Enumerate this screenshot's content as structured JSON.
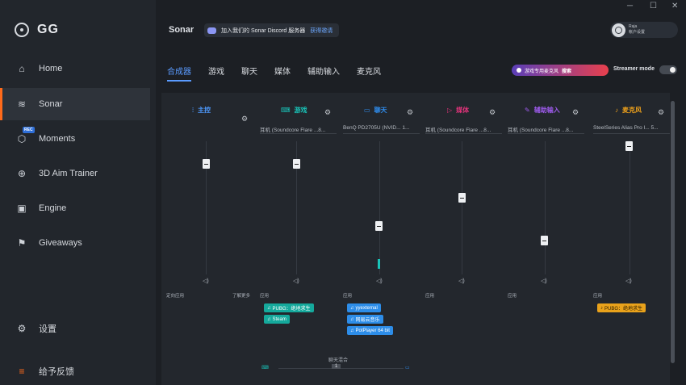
{
  "brand": {
    "name": "GG"
  },
  "window": {
    "minimize": "─",
    "maximize": "☐",
    "close": "✕"
  },
  "nav": [
    {
      "label": "Home",
      "icon": "home-icon"
    },
    {
      "label": "Sonar",
      "icon": "sonar-icon",
      "active": true
    },
    {
      "label": "Moments",
      "icon": "moments-icon",
      "badge": "REC"
    },
    {
      "label": "3D Aim Trainer",
      "icon": "crosshair-icon"
    },
    {
      "label": "Engine",
      "icon": "chip-icon"
    },
    {
      "label": "Giveaways",
      "icon": "gift-icon"
    }
  ],
  "sidebar_bottom": {
    "settings": "设置",
    "feedback": "给予反馈"
  },
  "header": {
    "title": "Sonar",
    "discord_text": "加入我们的 Sonar Discord 服务器",
    "discord_link": "获得邀请",
    "account_name": "Raja",
    "account_sub": "帐户设置"
  },
  "tabs": [
    "合成器",
    "游戏",
    "聊天",
    "媒体",
    "辅助输入",
    "麦克风"
  ],
  "mic_pill": {
    "text": "游戏专用麦克风",
    "action": "搜索"
  },
  "streamer_mode": {
    "label": "Streamer mode",
    "on": false
  },
  "channels": [
    {
      "name": "主控",
      "color": "#4e9bff",
      "device": "",
      "level": 0.86
    },
    {
      "name": "游戏",
      "color": "#19c3b8",
      "device": "耳机 (Soundcore Flare ...8...",
      "level": 0.86
    },
    {
      "name": "聊天",
      "color": "#2f8ef0",
      "device": "BenQ PD2705U (NVID... 1...",
      "level": 0.37
    },
    {
      "name": "媒体",
      "color": "#e0337a",
      "device": "耳机 (Soundcore Flare ...8...",
      "level": 0.56
    },
    {
      "name": "辅助输入",
      "color": "#a05cf0",
      "device": "耳机 (Soundcore Flare ...8...",
      "level": 0.27
    },
    {
      "name": "麦克风",
      "color": "#f0a21b",
      "device": "SteelSeries Alias Pro I... 5...",
      "level": 0.99
    }
  ],
  "routing": {
    "header_left": "定向应用",
    "header_right": "了解更多",
    "col_label": "应用",
    "game_apps": [
      "PUBG：绝地求生",
      "Steam"
    ],
    "chat_apps": [
      "yyexternal",
      "网易云音乐",
      "PotPlayer 64 bit"
    ],
    "mic_apps": [
      "PUBG：绝地求生"
    ]
  },
  "chat_mix": {
    "label": "聊天混合",
    "value": "1"
  }
}
